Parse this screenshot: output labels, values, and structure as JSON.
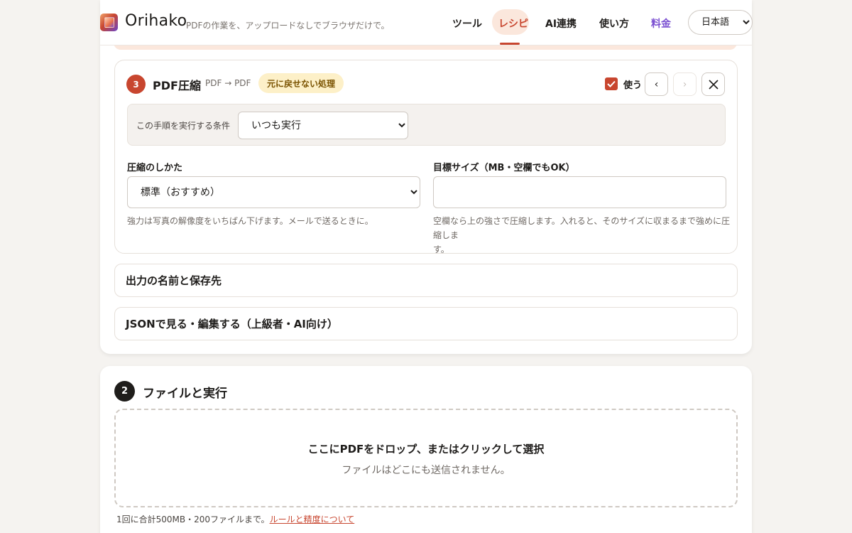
{
  "header": {
    "brand": "Orihako",
    "tagline": "PDFの作業を、アップロードなしでブラウザだけで。",
    "nav": [
      "ツール",
      "レシピ",
      "AI連携",
      "使い方",
      "料金"
    ],
    "active_nav": "レシピ",
    "language": "日本語",
    "colors": {
      "accent": "#c8462f",
      "pricing": "#7a4fd1"
    }
  },
  "step": {
    "number": "3",
    "title": "PDF圧縮",
    "io": "PDF → PDF",
    "badge": "元に戻せない処理",
    "use_label": "使う",
    "use_checked": true,
    "prev_label": "‹",
    "next_label": "›",
    "close_label": "✕",
    "condition": {
      "label": "この手順を実行する条件",
      "value": "いつも実行"
    },
    "compression": {
      "label": "圧縮のしかた",
      "value": "標準（おすすめ）",
      "hint": "強力は写真の解像度をいちばん下げます。メールで送るときに。"
    },
    "target_size": {
      "label": "目標サイズ（MB・空欄でもOK）",
      "value": "",
      "hint_line1": "空欄なら上の強さで圧縮します。入れると、そのサイズに収まるまで強めに圧縮しま",
      "hint_line2": "す。"
    }
  },
  "sections": {
    "output": "出力の名前と保存先",
    "json": "JSONで見る・編集する（上級者・AI向け）"
  },
  "files": {
    "number": "2",
    "title": "ファイルと実行",
    "drop_main": "ここにPDFをドロップ、またはクリックして選択",
    "drop_sub": "ファイルはどこにも送信されません。",
    "limits_text": "1回に合計500MB・200ファイルまで。",
    "rules_link": "ルールと精度について"
  }
}
